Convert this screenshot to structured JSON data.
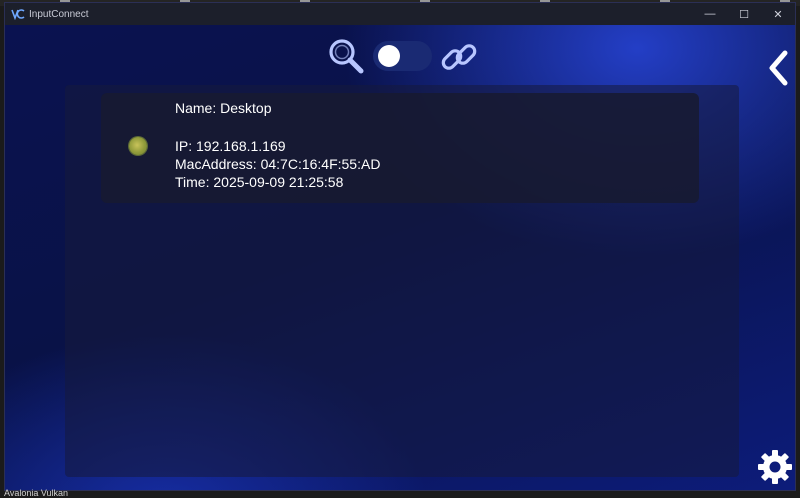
{
  "window": {
    "title": "InputConnect",
    "controls": {
      "minimize": "—",
      "maximize": "☐",
      "close": "✕"
    }
  },
  "toolbar": {
    "search_icon": "search-icon",
    "toggle": {
      "state": "off"
    },
    "link_icon": "link-icon",
    "back_icon": "chevron-left-icon"
  },
  "devices": [
    {
      "name_line": "Name: Desktop",
      "ip_line": "IP: 192.168.1.169",
      "mac_line": "MacAddress: 04:7C:16:4F:55:AD",
      "time_line": "Time: 2025-09-09 21:25:58",
      "status_color": "#9aa53f"
    }
  ],
  "settings_icon": "gear-icon",
  "footer_label": "Avalonia Vulkan",
  "colors": {
    "accent": "#1e3ccf",
    "background": "#0a1050",
    "card": "#181a30"
  }
}
